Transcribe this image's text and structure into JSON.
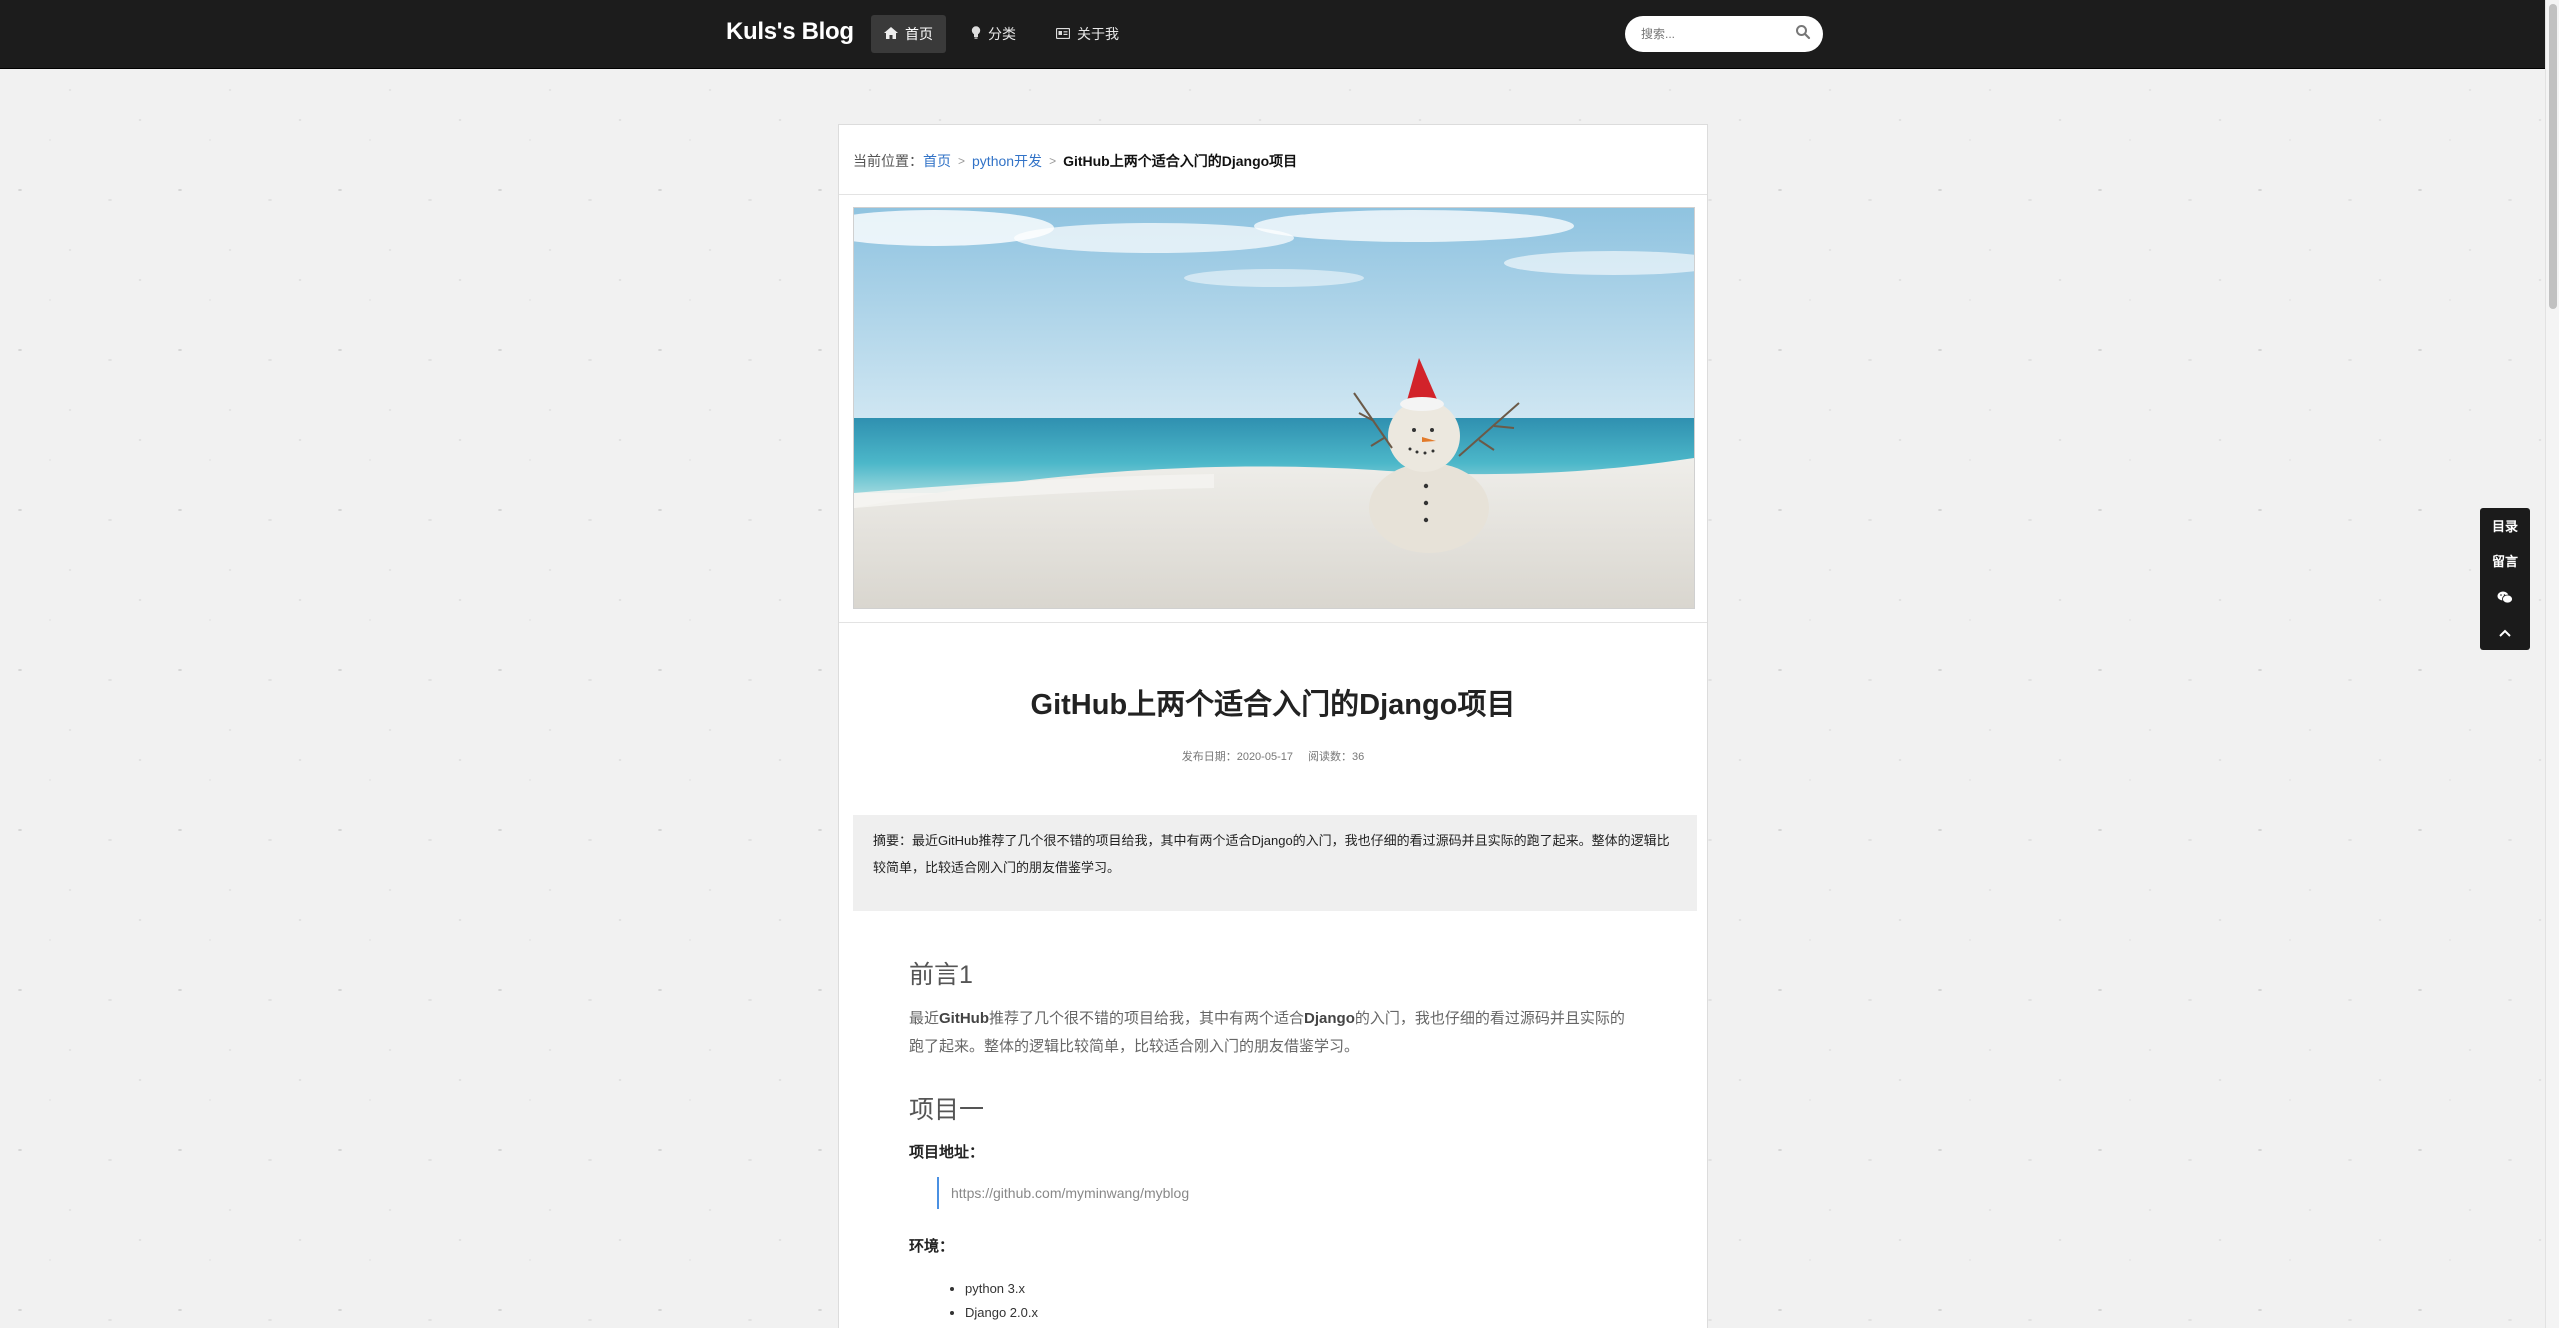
{
  "navbar": {
    "brand": "Kuls's Blog",
    "items": [
      {
        "label": "首页",
        "icon": "home-icon",
        "active": true
      },
      {
        "label": "分类",
        "icon": "lightbulb-icon",
        "active": false
      },
      {
        "label": "关于我",
        "icon": "id-card-icon",
        "active": false
      }
    ],
    "search": {
      "placeholder": "搜索..."
    }
  },
  "breadcrumb": {
    "prefix": "当前位置：",
    "items": [
      "首页",
      "python开发"
    ],
    "current": "GitHub上两个适合入门的Django项目"
  },
  "article": {
    "title": "GitHub上两个适合入门的Django项目",
    "meta": {
      "date_label": "发布日期：",
      "date": "2020-05-17",
      "reads_label": "阅读数：",
      "reads": "36"
    },
    "summary_label": "摘要：",
    "summary": "最近GitHub推荐了几个很不错的项目给我，其中有两个适合Django的入门，我也仔细的看过源码并且实际的跑了起来。整体的逻辑比较简单，比较适合刚入门的朋友借鉴学习。",
    "sections": {
      "h1": "前言1",
      "p1_a": "最近",
      "p1_b": "GitHub",
      "p1_c": "推荐了几个很不错的项目给我，其中有两个适合",
      "p1_d": "Django",
      "p1_e": "的入门，我也仔细的看过源码并且实际的跑了起来。整体的逻辑比较简单，比较适合刚入门的朋友借鉴学习。",
      "h2": "项目一",
      "project_addr_label": "项目地址：",
      "project_url": "https://github.com/myminwang/myblog",
      "env_label": "环境：",
      "env_items": [
        "python 3.x",
        "Django 2.0.x"
      ]
    }
  },
  "float_panel": {
    "items": [
      {
        "label": "目录"
      },
      {
        "label": "留言"
      },
      {
        "icon": "wechat-icon"
      },
      {
        "icon": "chevron-up-icon"
      }
    ]
  },
  "colors": {
    "navbar_bg": "#1c1c1c",
    "link": "#3273c7",
    "page_bg": "#f1f1f1"
  }
}
